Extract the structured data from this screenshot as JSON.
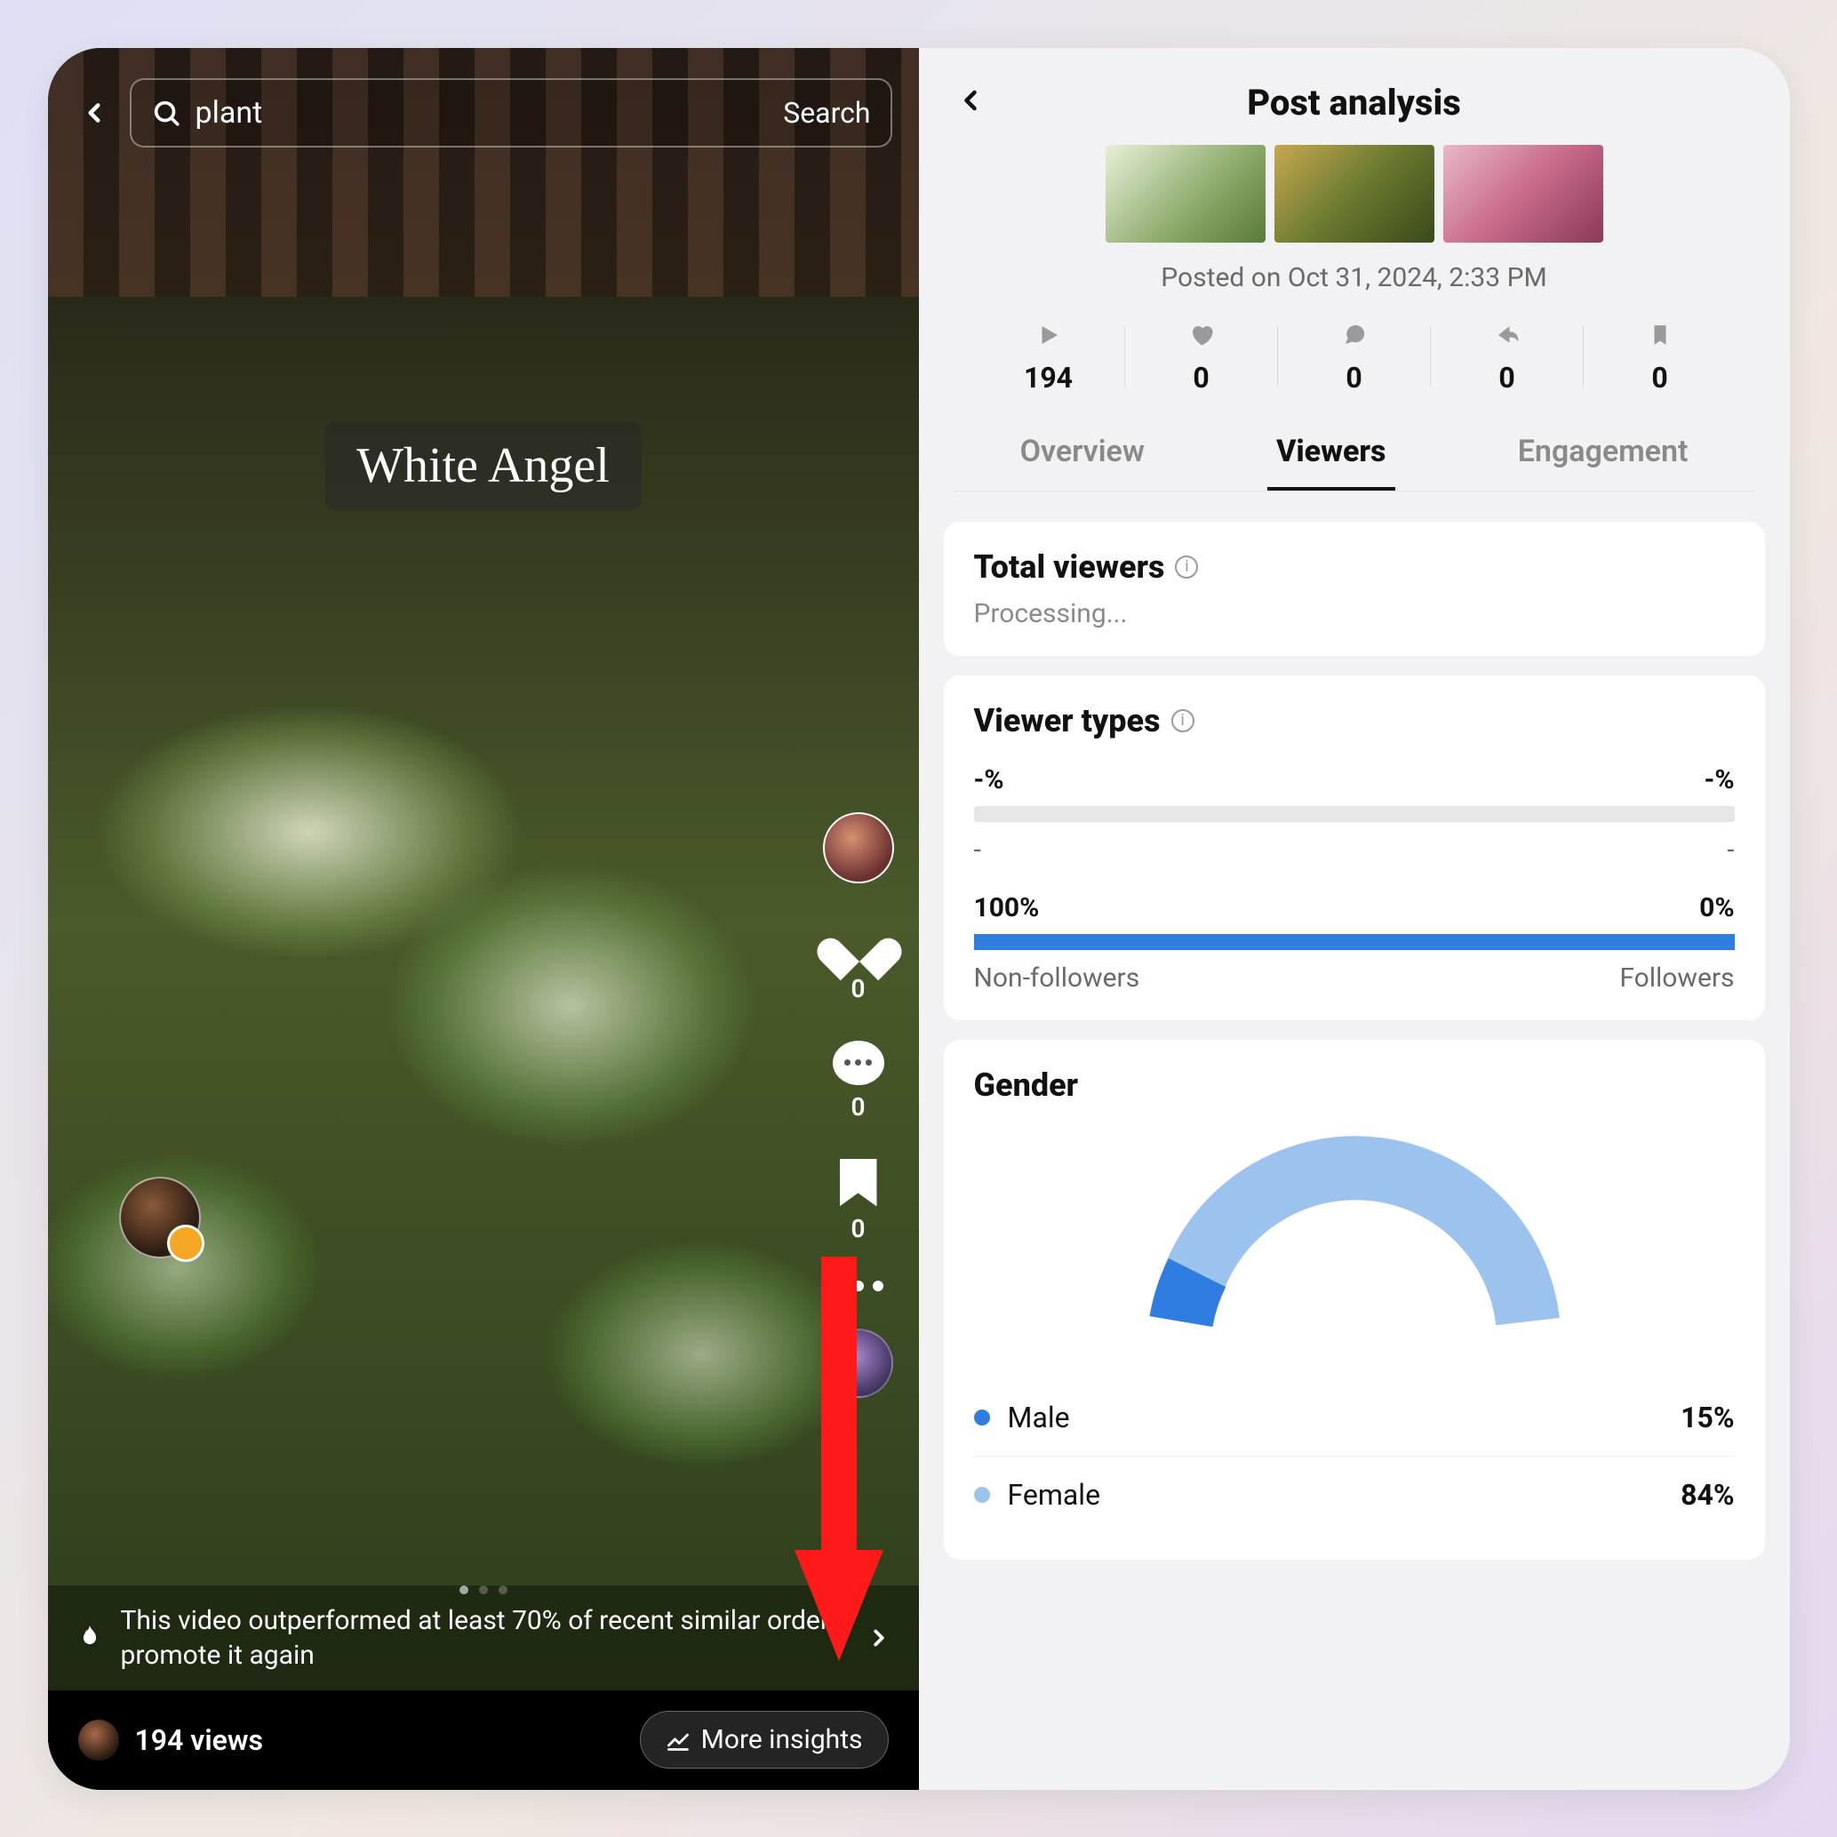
{
  "left": {
    "search_query": "plant",
    "search_button": "Search",
    "video_title": "White Angel",
    "rail": {
      "like_count": "0",
      "comment_count": "0",
      "bookmark_count": "0"
    },
    "promo_text": "This video outperformed at least 70% of recent similar orders, promote it again",
    "views_text": "194 views",
    "more_insights": "More insights"
  },
  "right": {
    "title": "Post analysis",
    "posted": "Posted on Oct 31, 2024, 2:33 PM",
    "stats": {
      "plays": "194",
      "likes": "0",
      "comments": "0",
      "shares": "0",
      "bookmarks": "0"
    },
    "tabs": {
      "overview": "Overview",
      "viewers": "Viewers",
      "engagement": "Engagement"
    },
    "total_viewers": {
      "heading": "Total viewers",
      "status": "Processing..."
    },
    "viewer_types": {
      "heading": "Viewer types",
      "row1": {
        "left_pct": "-%",
        "right_pct": "-%",
        "left_label": "-",
        "right_label": "-"
      },
      "row2": {
        "left_pct": "100%",
        "right_pct": "0%",
        "left_label": "Non-followers",
        "right_label": "Followers"
      }
    },
    "gender": {
      "heading": "Gender",
      "male_label": "Male",
      "male_pct": "15%",
      "female_label": "Female",
      "female_pct": "84%"
    }
  },
  "colors": {
    "blue_primary": "#2f7de1",
    "blue_light": "#9cc3ee"
  },
  "chart_data": {
    "type": "pie",
    "title": "Gender",
    "series": [
      {
        "name": "Male",
        "value": 15,
        "color": "#2f7de1"
      },
      {
        "name": "Female",
        "value": 84,
        "color": "#9cc3ee"
      }
    ],
    "style": "half-donut"
  }
}
